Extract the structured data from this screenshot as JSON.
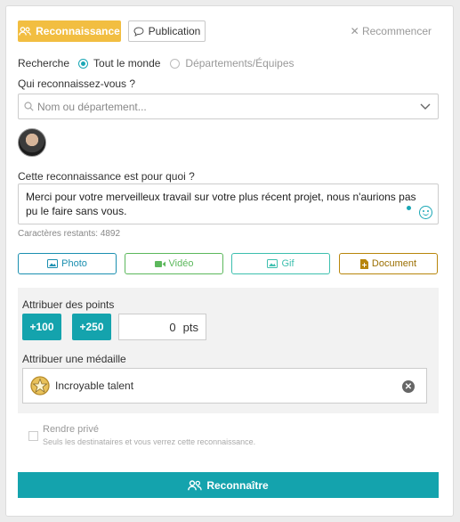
{
  "tabs": {
    "recognition": "Reconnaissance",
    "publication": "Publication",
    "reset": "Recommencer"
  },
  "search_scope": {
    "label": "Recherche",
    "options": [
      "Tout le monde",
      "Départements/Équipes"
    ],
    "selected": "Tout le monde"
  },
  "recipients": {
    "question": "Qui reconnaissez-vous ?",
    "placeholder": "Nom ou département..."
  },
  "message": {
    "question": "Cette reconnaissance est pour quoi ?",
    "text": "Merci pour votre merveilleux travail sur votre plus récent projet, nous n'aurions pas pu le faire sans vous.",
    "chars_remaining": "Caractères restants: 4892"
  },
  "media_buttons": {
    "photo": "Photo",
    "video": "Vidéo",
    "gif": "Gif",
    "document": "Document"
  },
  "points": {
    "label": "Attribuer des points",
    "quick_100": "+100",
    "quick_250": "+250",
    "value": "0",
    "unit": "pts"
  },
  "medal": {
    "label": "Attribuer une médaille",
    "selected": "Incroyable talent"
  },
  "private": {
    "label": "Rendre privé",
    "description": "Seuls les destinataires et vous verrez cette reconnaissance."
  },
  "submit_label": "Reconnaître",
  "colors": {
    "accent_teal": "#14a3ad",
    "tab_active_yellow": "#f2be41",
    "photo_border": "#1a8fb0",
    "video_green": "#5cb85c",
    "gif_teal": "#3cbfae",
    "document_brown": "#b8860b"
  }
}
